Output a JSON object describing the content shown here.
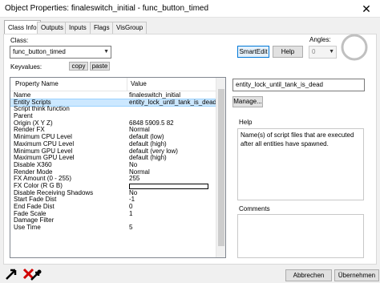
{
  "window": {
    "title": "Object Properties: finaleswitch_initial - func_button_timed",
    "close_glyph": "✕"
  },
  "tabs": [
    "Class Info",
    "Outputs",
    "Inputs",
    "Flags",
    "VisGroup"
  ],
  "class_section": {
    "label": "Class:",
    "value": "func_button_timed",
    "keyvalues_label": "Keyvalues:",
    "copy_label": "copy",
    "paste_label": "paste"
  },
  "toolbar": {
    "smartedit_label": "SmartEdit",
    "help_label": "Help"
  },
  "angles": {
    "label": "Angles:",
    "value": "0"
  },
  "grid": {
    "col_name": "Property Name",
    "col_value": "Value",
    "rows": [
      {
        "name": "Name",
        "value": "finaleswitch_initial"
      },
      {
        "name": "Entity Scripts",
        "value": "entity_lock_until_tank_is_dead",
        "selected": true
      },
      {
        "name": "Script think function",
        "value": ""
      },
      {
        "name": "Parent",
        "value": ""
      },
      {
        "name": "Origin (X Y Z)",
        "value": "6848 5909.5 82"
      },
      {
        "name": "Render FX",
        "value": "Normal"
      },
      {
        "name": "Minimum CPU Level",
        "value": "default (low)"
      },
      {
        "name": "Maximum CPU Level",
        "value": "default (high)"
      },
      {
        "name": "Minimum GPU Level",
        "value": "default (very low)"
      },
      {
        "name": "Maximum GPU Level",
        "value": "default (high)"
      },
      {
        "name": "Disable X360",
        "value": "No"
      },
      {
        "name": "Render Mode",
        "value": "Normal"
      },
      {
        "name": "FX Amount (0 - 255)",
        "value": "255"
      },
      {
        "name": "FX Color (R G B)",
        "value": "",
        "swatch": true
      },
      {
        "name": "Disable Receiving Shadows",
        "value": "No"
      },
      {
        "name": "Start Fade Dist",
        "value": "-1"
      },
      {
        "name": "End Fade Dist",
        "value": "0"
      },
      {
        "name": "Fade Scale",
        "value": "1"
      },
      {
        "name": "Damage Filter",
        "value": ""
      },
      {
        "name": "Use Time",
        "value": "5"
      }
    ]
  },
  "value_editor": {
    "value": "entity_lock_until_tank_is_dead",
    "manage_label": "Manage..."
  },
  "help_box": {
    "label": "Help",
    "text": "Name(s) of script files that are executed after all entities have spawned."
  },
  "comments_box": {
    "label": "Comments"
  },
  "footer": {
    "apply_label": "Abbrechen",
    "ok_label": "Übernehmen"
  },
  "colors": {
    "accent": "#0078d7",
    "selection": "#cce8ff"
  }
}
